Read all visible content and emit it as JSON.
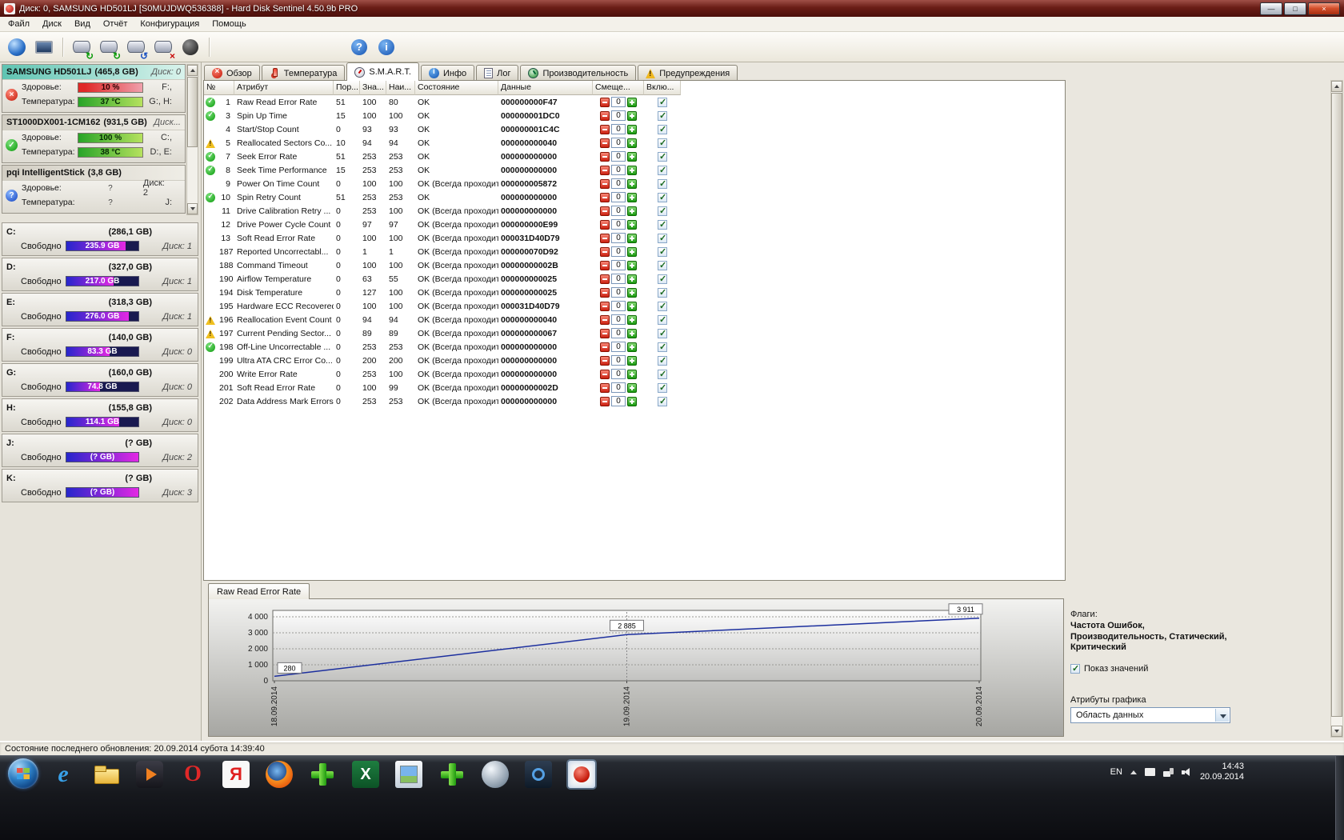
{
  "window": {
    "title": "Диск: 0, SAMSUNG HD501LJ [S0MUJDWQ536388]  -  Hard Disk Sentinel 4.50.9b PRO",
    "status_bar": "Состояние последнего обновления: 20.09.2014 субота 14:39:40",
    "controls": {
      "minimize": "—",
      "maximize": "□",
      "close": "×"
    }
  },
  "menu": [
    {
      "label": "Файл"
    },
    {
      "label": "Диск"
    },
    {
      "label": "Вид"
    },
    {
      "label": "Отчёт"
    },
    {
      "label": "Конфигурация"
    },
    {
      "label": "Помощь"
    }
  ],
  "icons": {
    "disk-ok": "✓",
    "disk-error": "×",
    "disk-unknown": "?",
    "row-ok": "✓",
    "row-warning": "!",
    "checkbox-check": "✓",
    "offset-minus": "−",
    "offset-plus": "+",
    "dropdown-arrow": "▼",
    "tray-expand": "▲"
  },
  "sidebar": {
    "health_label": "Здоровье:",
    "temp_label": "Температура:",
    "free_label": "Свободно",
    "disks": [
      {
        "name": "SAMSUNG HD501LJ",
        "size": "(465,8 GB)",
        "header_right": "Диск: 0",
        "status": "error",
        "health": "10 %",
        "health_class": "hb-red",
        "health_right": "F:,",
        "temp": "37 °C",
        "temp_class": "hb-green",
        "temp_right": "G:, H:",
        "state": "selected"
      },
      {
        "name": "ST1000DX001-1CM162",
        "size": "(931,5 GB)",
        "header_right": "Диск...",
        "status": "ok",
        "health": "100 %",
        "health_class": "hb-green",
        "health_right": "C:,",
        "temp": "38 °C",
        "temp_class": "hb-green",
        "temp_right": "D:, E:",
        "state": ""
      },
      {
        "name": "pqi IntelligentStick",
        "size": "(3,8 GB)",
        "header_right": "",
        "status": "unknown",
        "health": "?",
        "health_class": "hb-none",
        "health_right": "Диск: 2",
        "temp": "?",
        "temp_class": "hb-none",
        "temp_right": "J:",
        "state": ""
      }
    ],
    "partitions": [
      {
        "letter": "C:",
        "size": "(286,1 GB)",
        "free": "235.9 GB",
        "disk": "Диск: 1",
        "pct": "82%"
      },
      {
        "letter": "D:",
        "size": "(327,0 GB)",
        "free": "217.0 GB",
        "disk": "Диск: 1",
        "pct": "66%"
      },
      {
        "letter": "E:",
        "size": "(318,3 GB)",
        "free": "276.0 GB",
        "disk": "Диск: 1",
        "pct": "87%"
      },
      {
        "letter": "F:",
        "size": "(140,0 GB)",
        "free": "83.3 GB",
        "disk": "Диск: 0",
        "pct": "60%"
      },
      {
        "letter": "G:",
        "size": "(160,0 GB)",
        "free": "74.8 GB",
        "disk": "Диск: 0",
        "pct": "47%"
      },
      {
        "letter": "H:",
        "size": "(155,8 GB)",
        "free": "114.1 GB",
        "disk": "Диск: 0",
        "pct": "73%"
      },
      {
        "letter": "J:",
        "size": "(? GB)",
        "free": "(? GB)",
        "disk": "Диск: 2",
        "pct": "100%"
      },
      {
        "letter": "K:",
        "size": "(? GB)",
        "free": "(? GB)",
        "disk": "Диск: 3",
        "pct": "100%"
      }
    ]
  },
  "tabs": [
    {
      "label": "Обзор",
      "icon": "ic-overview",
      "state": ""
    },
    {
      "label": "Температура",
      "icon": "ic-temp",
      "state": ""
    },
    {
      "label": "S.M.A.R.T.",
      "icon": "ic-smart",
      "state": "active"
    },
    {
      "label": "Инфо",
      "icon": "ic-info",
      "state": ""
    },
    {
      "label": "Лог",
      "icon": "ic-log",
      "state": ""
    },
    {
      "label": "Производительность",
      "icon": "ic-perf",
      "state": ""
    },
    {
      "label": "Предупреждения",
      "icon": "ic-alert",
      "state": ""
    }
  ],
  "smart_table": {
    "headers": [
      "№",
      "Атрибут",
      "Пор...",
      "Зна...",
      "Наи...",
      "Состояние",
      "Данные",
      "Смеще...",
      "Вклю..."
    ],
    "rows": [
      {
        "icon": "ok",
        "id": "1",
        "attr": "Raw Read Error Rate",
        "thr": "51",
        "val": "100",
        "worst": "80",
        "status": "OK",
        "data": "000000000F47",
        "offset": "0"
      },
      {
        "icon": "ok",
        "id": "3",
        "attr": "Spin Up Time",
        "thr": "15",
        "val": "100",
        "worst": "100",
        "status": "OK",
        "data": "000000001DC0",
        "offset": "0"
      },
      {
        "icon": "none",
        "id": "4",
        "attr": "Start/Stop Count",
        "thr": "0",
        "val": "93",
        "worst": "93",
        "status": "OK",
        "data": "000000001C4C",
        "offset": "0"
      },
      {
        "icon": "warn",
        "id": "5",
        "attr": "Reallocated Sectors Co...",
        "thr": "10",
        "val": "94",
        "worst": "94",
        "status": "OK",
        "data": "000000000040",
        "offset": "0"
      },
      {
        "icon": "ok",
        "id": "7",
        "attr": "Seek Error Rate",
        "thr": "51",
        "val": "253",
        "worst": "253",
        "status": "OK",
        "data": "000000000000",
        "offset": "0"
      },
      {
        "icon": "ok",
        "id": "8",
        "attr": "Seek Time Performance",
        "thr": "15",
        "val": "253",
        "worst": "253",
        "status": "OK",
        "data": "000000000000",
        "offset": "0"
      },
      {
        "icon": "none",
        "id": "9",
        "attr": "Power On Time Count",
        "thr": "0",
        "val": "100",
        "worst": "100",
        "status": "OK (Всегда проходит)",
        "data": "000000005872",
        "offset": "0"
      },
      {
        "icon": "ok",
        "id": "10",
        "attr": "Spin Retry Count",
        "thr": "51",
        "val": "253",
        "worst": "253",
        "status": "OK",
        "data": "000000000000",
        "offset": "0"
      },
      {
        "icon": "none",
        "id": "11",
        "attr": "Drive Calibration Retry ...",
        "thr": "0",
        "val": "253",
        "worst": "100",
        "status": "OK (Всегда проходит)",
        "data": "000000000000",
        "offset": "0"
      },
      {
        "icon": "none",
        "id": "12",
        "attr": "Drive Power Cycle Count",
        "thr": "0",
        "val": "97",
        "worst": "97",
        "status": "OK (Всегда проходит)",
        "data": "000000000E99",
        "offset": "0"
      },
      {
        "icon": "none",
        "id": "13",
        "attr": "Soft Read Error Rate",
        "thr": "0",
        "val": "100",
        "worst": "100",
        "status": "OK (Всегда проходит)",
        "data": "000031D40D79",
        "offset": "0"
      },
      {
        "icon": "none",
        "id": "187",
        "attr": "Reported Uncorrectabl...",
        "thr": "0",
        "val": "1",
        "worst": "1",
        "status": "OK (Всегда проходит)",
        "data": "000000070D92",
        "offset": "0"
      },
      {
        "icon": "none",
        "id": "188",
        "attr": "Command Timeout",
        "thr": "0",
        "val": "100",
        "worst": "100",
        "status": "OK (Всегда проходит)",
        "data": "00000000002B",
        "offset": "0"
      },
      {
        "icon": "none",
        "id": "190",
        "attr": "Airflow Temperature",
        "thr": "0",
        "val": "63",
        "worst": "55",
        "status": "OK (Всегда проходит)",
        "data": "000000000025",
        "offset": "0"
      },
      {
        "icon": "none",
        "id": "194",
        "attr": "Disk Temperature",
        "thr": "0",
        "val": "127",
        "worst": "100",
        "status": "OK (Всегда проходит)",
        "data": "000000000025",
        "offset": "0"
      },
      {
        "icon": "none",
        "id": "195",
        "attr": "Hardware ECC Recovered",
        "thr": "0",
        "val": "100",
        "worst": "100",
        "status": "OK (Всегда проходит)",
        "data": "000031D40D79",
        "offset": "0"
      },
      {
        "icon": "warn",
        "id": "196",
        "attr": "Reallocation Event Count",
        "thr": "0",
        "val": "94",
        "worst": "94",
        "status": "OK (Всегда проходит)",
        "data": "000000000040",
        "offset": "0"
      },
      {
        "icon": "warn",
        "id": "197",
        "attr": "Current Pending Sector...",
        "thr": "0",
        "val": "89",
        "worst": "89",
        "status": "OK (Всегда проходит)",
        "data": "000000000067",
        "offset": "0"
      },
      {
        "icon": "ok",
        "id": "198",
        "attr": "Off-Line Uncorrectable ...",
        "thr": "0",
        "val": "253",
        "worst": "253",
        "status": "OK (Всегда проходит)",
        "data": "000000000000",
        "offset": "0"
      },
      {
        "icon": "none",
        "id": "199",
        "attr": "Ultra ATA CRC Error Co...",
        "thr": "0",
        "val": "200",
        "worst": "200",
        "status": "OK (Всегда проходит)",
        "data": "000000000000",
        "offset": "0"
      },
      {
        "icon": "none",
        "id": "200",
        "attr": "Write Error Rate",
        "thr": "0",
        "val": "253",
        "worst": "100",
        "status": "OK (Всегда проходит)",
        "data": "000000000000",
        "offset": "0"
      },
      {
        "icon": "none",
        "id": "201",
        "attr": "Soft Read Error Rate",
        "thr": "0",
        "val": "100",
        "worst": "99",
        "status": "OK (Всегда проходит)",
        "data": "00000000002D",
        "offset": "0"
      },
      {
        "icon": "none",
        "id": "202",
        "attr": "Data Address Mark Errors",
        "thr": "0",
        "val": "253",
        "worst": "253",
        "status": "OK (Всегда проходит)",
        "data": "000000000000",
        "offset": "0"
      }
    ]
  },
  "chart_data": {
    "type": "line",
    "title": "Raw Read Error Rate",
    "x": [
      "18.09.2014",
      "19.09.2014",
      "20.09.2014"
    ],
    "values": [
      280,
      2885,
      3911
    ],
    "ylim": [
      0,
      4000
    ],
    "ytick_step": 1000,
    "ytick_labels": [
      "0",
      "1 000",
      "2 000",
      "3 000",
      "4 000"
    ],
    "point_labels": [
      "280",
      "2 885",
      "3 911"
    ],
    "grid": true,
    "line_color": "#1c2f9e",
    "legend_position": "none"
  },
  "flags_panel": {
    "title": "Флаги:",
    "lines": [
      "Частота Ошибок,",
      "Производительность, Статический,",
      "Критический"
    ],
    "show_values": "Показ значений",
    "attrs_label": "Атрибуты графика",
    "dropdown_value": "Область данных"
  },
  "taskbar": {
    "icons": [
      {
        "name": "ie-icon",
        "cls": "tb-ie"
      },
      {
        "name": "explorer-folder-icon",
        "cls": "tb-folder"
      },
      {
        "name": "media-player-icon",
        "cls": "tb-media"
      },
      {
        "name": "opera-icon",
        "cls": "tb-opera"
      },
      {
        "name": "yandex-browser-icon",
        "cls": "tb-yandex"
      },
      {
        "name": "firefox-icon",
        "cls": "tb-firefox"
      },
      {
        "name": "green-cross-app-icon",
        "cls": "tb-cross"
      },
      {
        "name": "excel-icon",
        "cls": "tb-excel"
      },
      {
        "name": "photo-viewer-icon",
        "cls": "tb-photo"
      },
      {
        "name": "green-cross-app2-icon",
        "cls": "tb-cross"
      },
      {
        "name": "utility-ball-icon",
        "cls": "tb-util"
      },
      {
        "name": "settings-app-icon",
        "cls": "tb-settings"
      },
      {
        "name": "hdsentinel-icon",
        "cls": "tb-hds"
      }
    ],
    "tray": {
      "lang": "EN",
      "time": "14:43",
      "date": "20.09.2014"
    }
  }
}
